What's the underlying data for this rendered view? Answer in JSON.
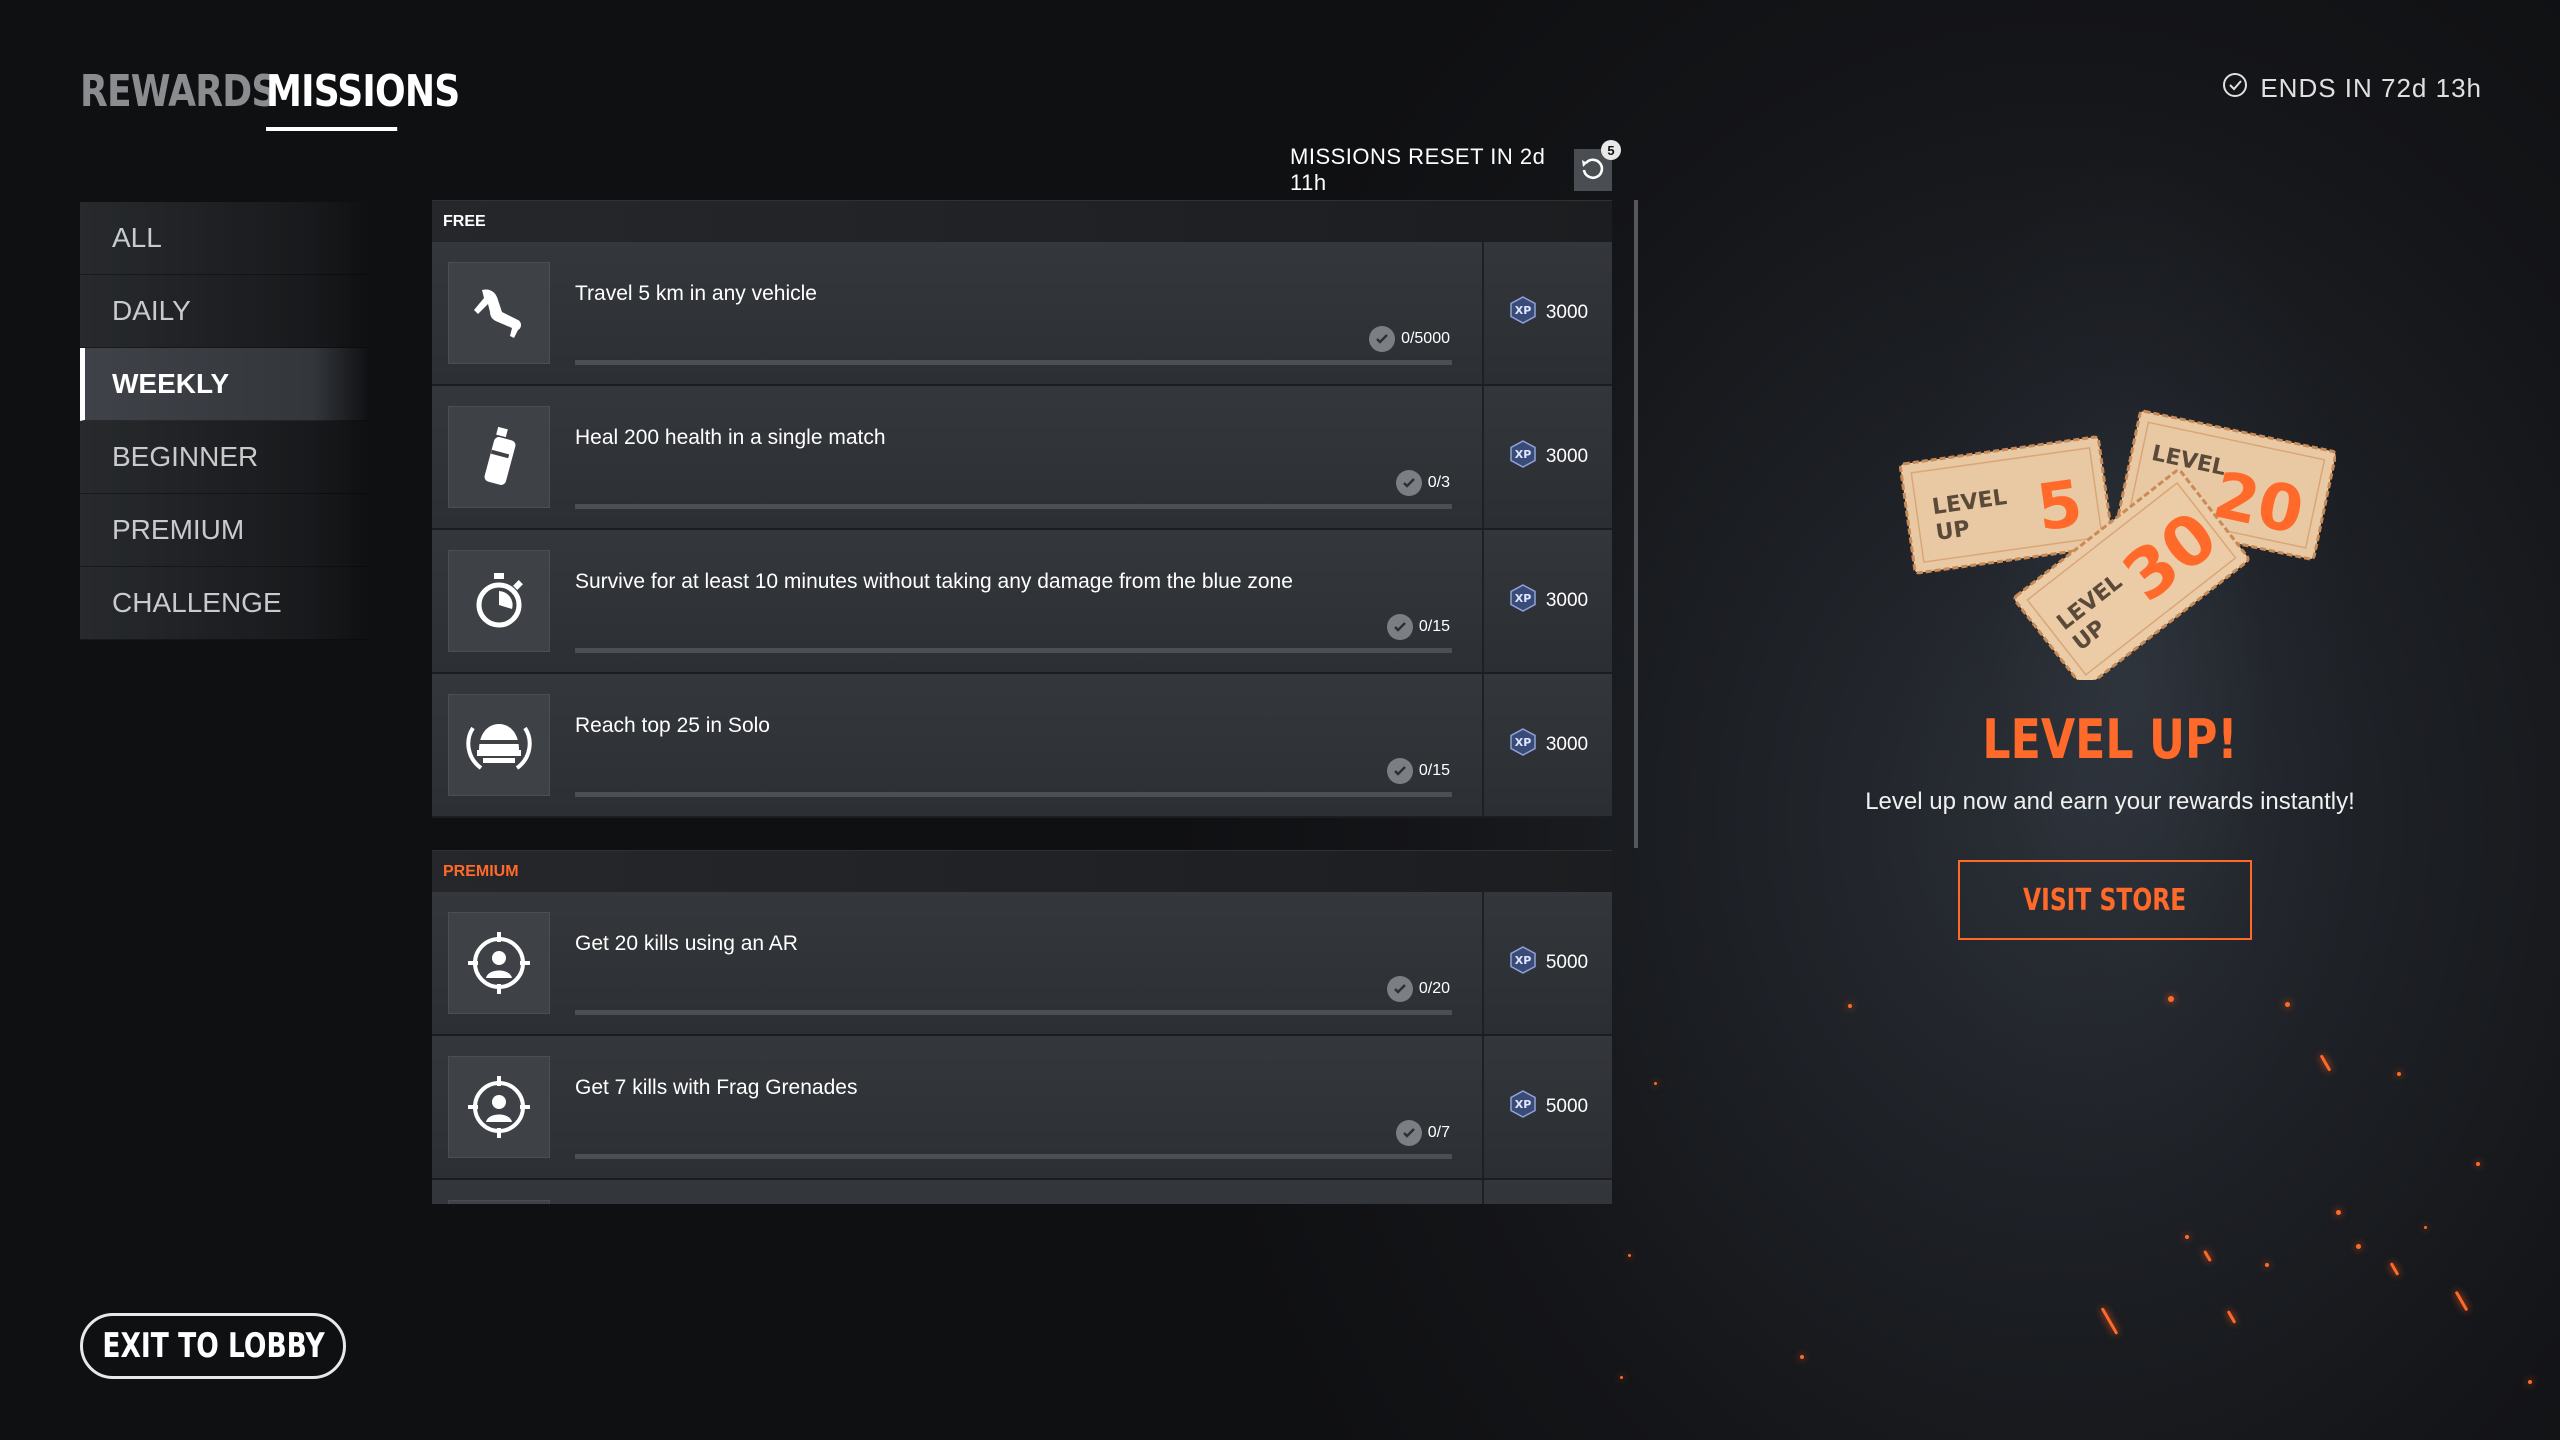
{
  "top_tabs": [
    {
      "label": "REWARDS",
      "active": false
    },
    {
      "label": "MISSIONS",
      "active": true
    }
  ],
  "ends_in": {
    "icon": "check-circle-icon",
    "text": "ENDS IN 72d 13h"
  },
  "side_nav": [
    {
      "label": "ALL",
      "active": false
    },
    {
      "label": "DAILY",
      "active": false
    },
    {
      "label": "WEEKLY",
      "active": true
    },
    {
      "label": "BEGINNER",
      "active": false
    },
    {
      "label": "PREMIUM",
      "active": false
    },
    {
      "label": "CHALLENGE",
      "active": false
    }
  ],
  "reset": {
    "text": "MISSIONS RESET IN 2d 11h",
    "icon": "refresh-icon",
    "badge": "5"
  },
  "sections": {
    "free": {
      "label": "FREE",
      "missions": [
        {
          "icon": "running-legs-icon",
          "title": "Travel 5 km in any vehicle",
          "progress": "0/5000",
          "progress_fraction": 0,
          "reward": "3000"
        },
        {
          "icon": "spray-can-icon",
          "title": "Heal 200 health in a single match",
          "progress": "0/3",
          "progress_fraction": 0,
          "reward": "3000"
        },
        {
          "icon": "stopwatch-icon",
          "title": "Survive for at least 10 minutes without taking any damage from the blue zone",
          "progress": "0/15",
          "progress_fraction": 0,
          "reward": "3000"
        },
        {
          "icon": "helmet-laurel-icon",
          "title": "Reach top 25 in Solo",
          "progress": "0/15",
          "progress_fraction": 0,
          "reward": "3000"
        }
      ]
    },
    "premium": {
      "label": "PREMIUM",
      "missions": [
        {
          "icon": "crosshair-person-icon",
          "title": "Get 20 kills using an AR",
          "progress": "0/20",
          "progress_fraction": 0,
          "reward": "5000"
        },
        {
          "icon": "crosshair-person-icon",
          "title": "Get 7 kills with Frag Grenades",
          "progress": "0/7",
          "progress_fraction": 0,
          "reward": "5000"
        }
      ]
    }
  },
  "reward_icon": "xp-hexagon-icon",
  "promo": {
    "tickets": [
      {
        "word1": "LEVEL",
        "word2": "UP",
        "number": "5"
      },
      {
        "word1": "LEVEL",
        "word2": "",
        "number": "20"
      },
      {
        "word1": "LEVEL",
        "word2": "UP",
        "number": "30"
      }
    ],
    "title": "LEVEL UP!",
    "subtitle": "Level up now and earn your rewards instantly!",
    "cta": "VISIT STORE"
  },
  "exit_button": "EXIT TO LOBBY",
  "colors": {
    "accent": "#ff6a2a",
    "ticket": "#e9c9a3",
    "ticket_border": "#c98a56"
  }
}
